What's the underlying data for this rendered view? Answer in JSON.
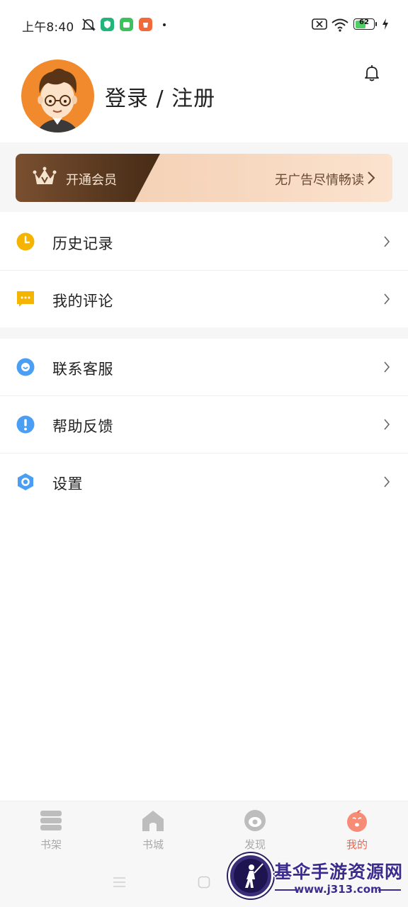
{
  "status_bar": {
    "time": "上午8:40",
    "battery": "62",
    "battery_level": 0.62,
    "icons": [
      "mute-bell-icon",
      "app-shield-icon",
      "app-android-icon",
      "app-bag-icon",
      "sim-off-icon",
      "wifi-icon",
      "battery-icon",
      "charging-icon"
    ]
  },
  "profile": {
    "login_label": "登录 / 注册",
    "avatar": "cartoon-boy-avatar",
    "notification_icon": "bell-icon"
  },
  "vip": {
    "left_label": "开通会员",
    "right_label": "无广告尽情畅读",
    "icon": "crown-icon"
  },
  "menu": {
    "group1": [
      {
        "label": "历史记录",
        "icon": "clock-icon",
        "color": "#f5b400"
      },
      {
        "label": "我的评论",
        "icon": "comment-icon",
        "color": "#f5b400"
      }
    ],
    "group2": [
      {
        "label": "联系客服",
        "icon": "service-icon",
        "color": "#4a9ff5"
      },
      {
        "label": "帮助反馈",
        "icon": "help-icon",
        "color": "#4a9ff5"
      },
      {
        "label": "设置",
        "icon": "settings-icon",
        "color": "#4a9ff5"
      }
    ]
  },
  "tabs": [
    {
      "label": "书架",
      "icon": "bookshelf-icon",
      "active": false
    },
    {
      "label": "书城",
      "icon": "bookstore-icon",
      "active": false
    },
    {
      "label": "发现",
      "icon": "discover-icon",
      "active": false
    },
    {
      "label": "我的",
      "icon": "profile-icon",
      "active": true
    }
  ],
  "colors": {
    "accent": "#f1654d",
    "tab_inactive": "#a9a9a9",
    "vip_dark": "#54351d",
    "vip_light": "#f6d6bd"
  },
  "watermark": {
    "title": "基伞手游资源网",
    "url": "www.j313.com"
  }
}
